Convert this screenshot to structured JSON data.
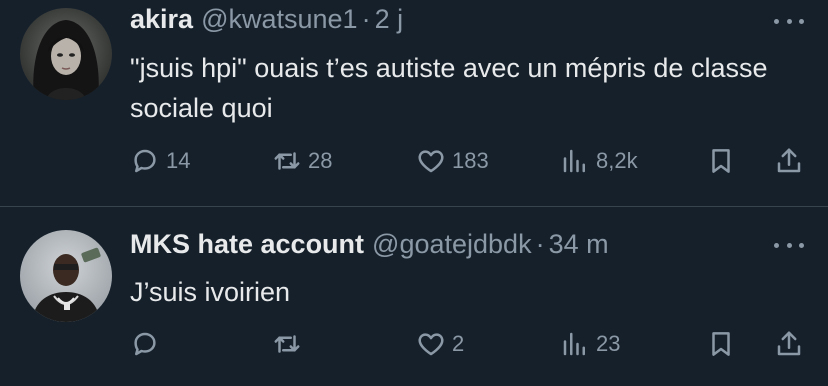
{
  "tweets": [
    {
      "display_name": "akira",
      "handle": "@kwatsune1",
      "separator": "·",
      "time": "2 j",
      "text": "\"jsuis hpi\" ouais t’es autiste avec un mépris de classe sociale quoi",
      "actions": {
        "replies": "14",
        "retweets": "28",
        "likes": "183",
        "views": "8,2k"
      }
    },
    {
      "display_name": "MKS hate account",
      "handle": "@goatejdbdk",
      "separator": "·",
      "time": "34 m",
      "text": "J’suis ivoirien",
      "actions": {
        "replies": "",
        "retweets": "",
        "likes": "2",
        "views": "23"
      }
    }
  ],
  "icons": {
    "reply": "speech-bubble-icon",
    "retweet": "retweet-arrows-icon",
    "like": "heart-icon",
    "views": "bar-chart-icon",
    "bookmark": "bookmark-icon",
    "share": "share-upload-icon",
    "more": "ellipsis-icon"
  },
  "colors": {
    "background": "#15202b",
    "text_primary": "#e7e9ea",
    "text_secondary": "#8b98a5",
    "divider": "#38444d"
  }
}
